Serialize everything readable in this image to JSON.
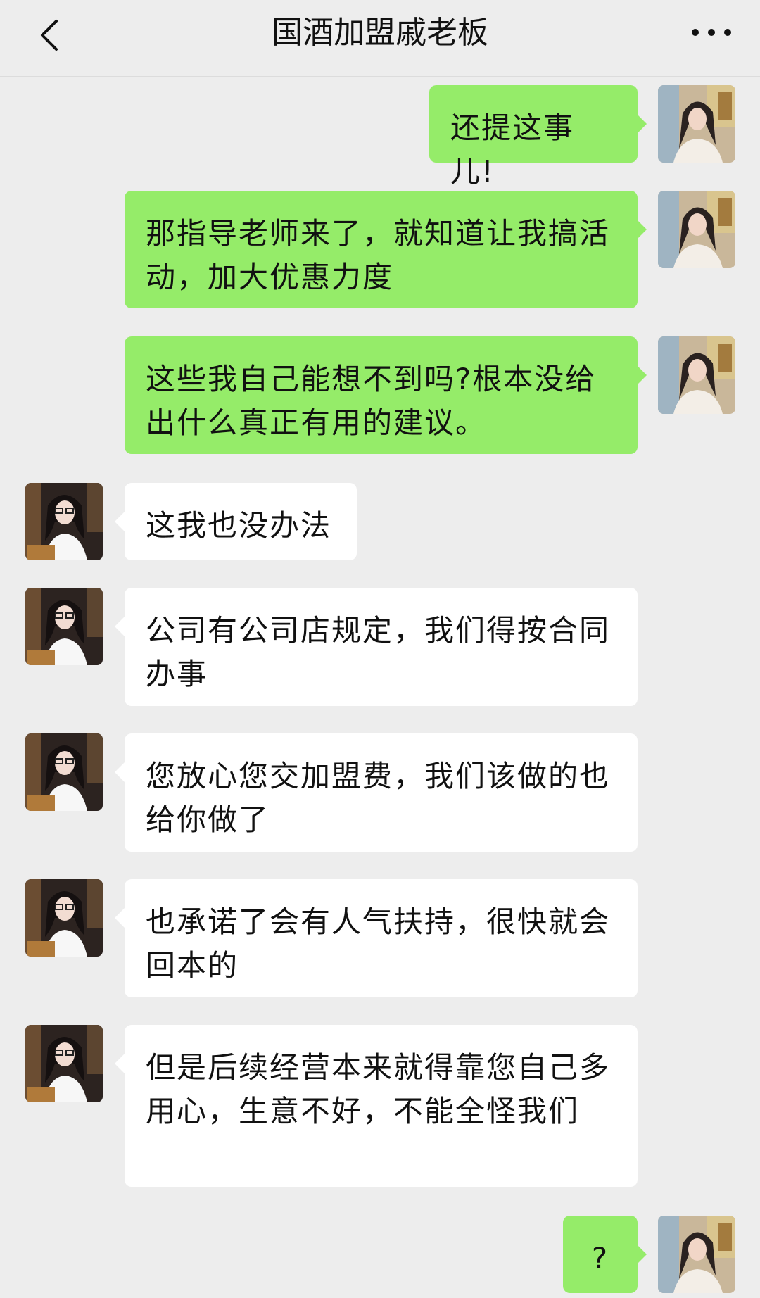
{
  "header": {
    "title": "国酒加盟戚老板"
  },
  "icons": {
    "back": "chevron-left-icon",
    "more": "more-dots-icon"
  },
  "colors": {
    "self_bubble": "#95ec69",
    "other_bubble": "#ffffff",
    "background": "#ededed"
  },
  "messages": [
    {
      "sender": "self",
      "text": "还提这事儿!"
    },
    {
      "sender": "self",
      "text": "那指导老师来了，就知道让我搞活动，加大优惠力度"
    },
    {
      "sender": "self",
      "text": "这些我自己能想不到吗?根本没给出什么真正有用的建议。"
    },
    {
      "sender": "other",
      "text": "这我也没办法"
    },
    {
      "sender": "other",
      "text": "公司有公司店规定，我们得按合同办事"
    },
    {
      "sender": "other",
      "text": "您放心您交加盟费，我们该做的也给你做了"
    },
    {
      "sender": "other",
      "text": "也承诺了会有人气扶持，很快就会回本的"
    },
    {
      "sender": "other",
      "text": "但是后续经营本来就得靠您自己多用心，生意不好，不能全怪我们"
    },
    {
      "sender": "self",
      "text": "?"
    }
  ]
}
